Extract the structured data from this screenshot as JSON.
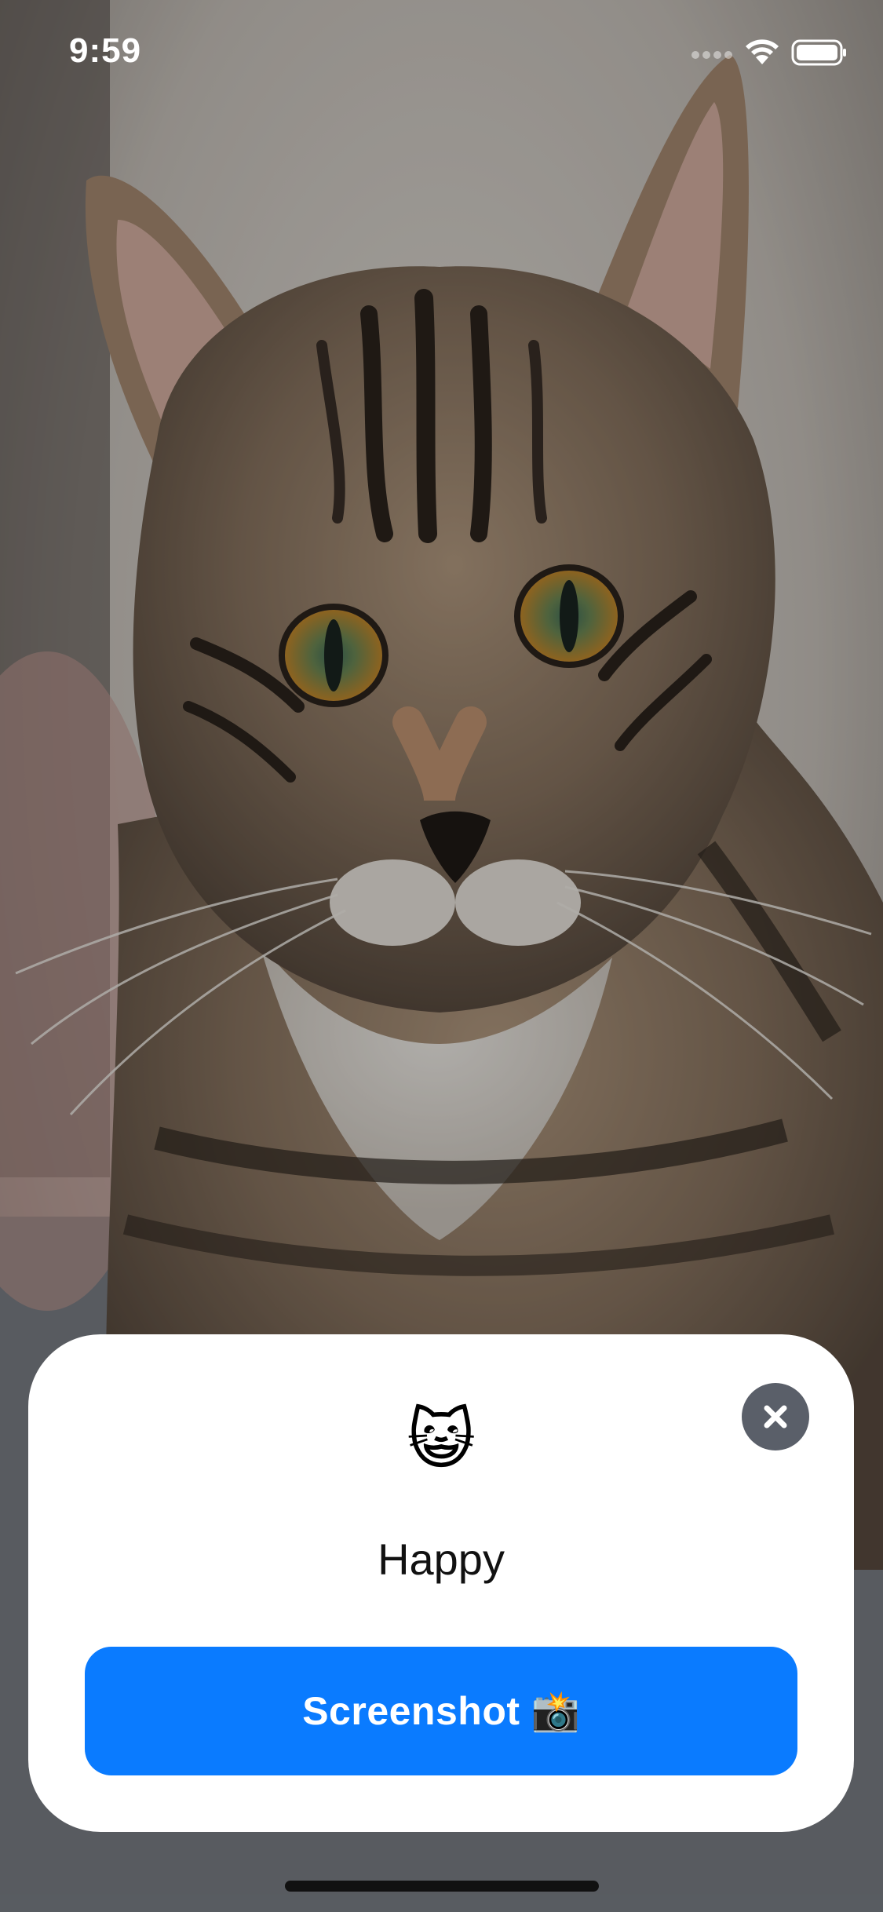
{
  "status_bar": {
    "time": "9:59"
  },
  "background": {
    "icon": "cat-photo"
  },
  "sheet": {
    "emoji": "😺",
    "mood": "Happy",
    "close_icon": "close-icon",
    "button": {
      "label": "Screenshot",
      "emoji": "📸",
      "color": "#0a7bff"
    }
  }
}
